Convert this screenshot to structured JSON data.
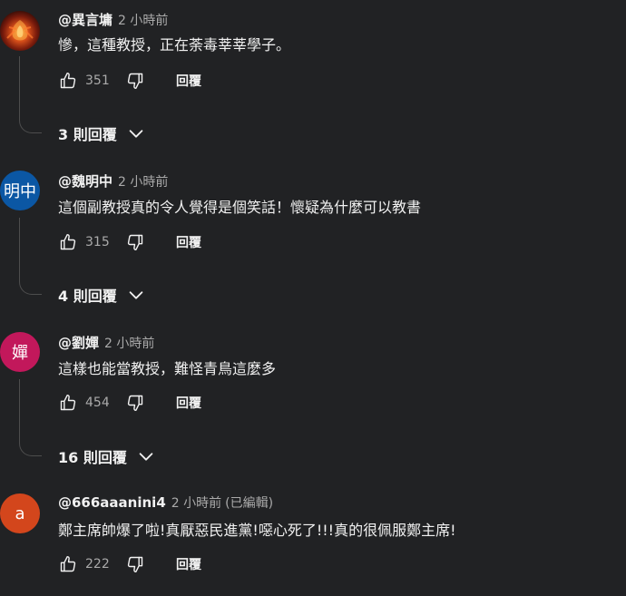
{
  "comments": [
    {
      "author": "@異言墉",
      "time": "2 小時前",
      "edited": "",
      "text": "慘，這種教授，正在荼毒莘莘學子。",
      "likes": "351",
      "reply_label": "回覆",
      "replies_label": "3 則回覆",
      "avatar": {
        "type": "image",
        "icon": "fiery-creature-icon"
      }
    },
    {
      "author": "@魏明中",
      "time": "2 小時前",
      "edited": "",
      "text": "這個副教授真的令人覺得是個笑話！懷疑為什麼可以教書",
      "likes": "315",
      "reply_label": "回覆",
      "replies_label": "4 則回覆",
      "avatar": {
        "type": "initials",
        "initials": "明中",
        "color": "#0b57a4"
      }
    },
    {
      "author": "@劉嬋",
      "time": "2 小時前",
      "edited": "",
      "text": "這樣也能當教授，難怪青鳥這麼多",
      "likes": "454",
      "reply_label": "回覆",
      "replies_label": "16 則回覆",
      "avatar": {
        "type": "initials",
        "initials": "嬋",
        "color": "#c2185b"
      }
    },
    {
      "author": "@666aaanini4",
      "time": "2 小時前",
      "edited": "(已編輯)",
      "text": "鄭主席帥爆了啦!真厭惡民進黨!噁心死了!!!真的很佩服鄭主席!",
      "likes": "222",
      "reply_label": "回覆",
      "replies_label": "",
      "avatar": {
        "type": "initials",
        "initials": "a",
        "color": "#d3461c"
      }
    }
  ],
  "icons": {
    "like": "thumbs-up-icon",
    "dislike": "thumbs-down-icon",
    "expand": "chevron-down-icon"
  },
  "colors": {
    "background": "#212224",
    "text": "#f1f1f1",
    "secondary_text": "#aaaaaa"
  }
}
